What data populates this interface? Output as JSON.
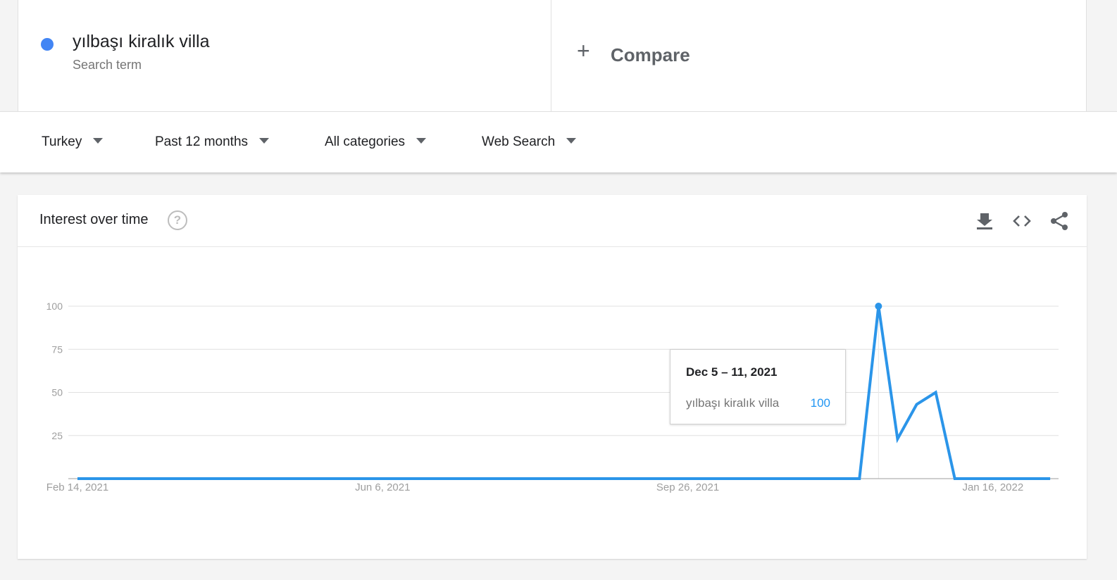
{
  "search_term": {
    "name": "yılbaşı kiralık villa",
    "subtitle": "Search term",
    "color": "#4285f4"
  },
  "compare": {
    "label": "Compare",
    "icon": "plus-icon"
  },
  "filters": [
    {
      "label": "Turkey"
    },
    {
      "label": "Past 12 months"
    },
    {
      "label": "All categories"
    },
    {
      "label": "Web Search"
    }
  ],
  "panel": {
    "title": "Interest over time",
    "icons": [
      "help-icon",
      "download-icon",
      "embed-code-icon",
      "share-icon"
    ]
  },
  "tooltip": {
    "date": "Dec 5 – 11, 2021",
    "term": "yılbaşı kiralık villa",
    "value": "100"
  },
  "chart_data": {
    "type": "line",
    "title": "",
    "xlabel": "",
    "ylabel": "",
    "ylim": [
      0,
      100
    ],
    "yticks": [
      25,
      50,
      75,
      100
    ],
    "x_tick_labels": [
      "Feb 14, 2021",
      "Jun 6, 2021",
      "Sep 26, 2021",
      "Jan 16, 2022"
    ],
    "x": [
      "2021-02-14",
      "2021-02-21",
      "2021-02-28",
      "2021-03-07",
      "2021-03-14",
      "2021-03-21",
      "2021-03-28",
      "2021-04-04",
      "2021-04-11",
      "2021-04-18",
      "2021-04-25",
      "2021-05-02",
      "2021-05-09",
      "2021-05-16",
      "2021-05-23",
      "2021-05-30",
      "2021-06-06",
      "2021-06-13",
      "2021-06-20",
      "2021-06-27",
      "2021-07-04",
      "2021-07-11",
      "2021-07-18",
      "2021-07-25",
      "2021-08-01",
      "2021-08-08",
      "2021-08-15",
      "2021-08-22",
      "2021-08-29",
      "2021-09-05",
      "2021-09-12",
      "2021-09-19",
      "2021-09-26",
      "2021-10-03",
      "2021-10-10",
      "2021-10-17",
      "2021-10-24",
      "2021-10-31",
      "2021-11-07",
      "2021-11-14",
      "2021-11-21",
      "2021-11-28",
      "2021-12-05",
      "2021-12-12",
      "2021-12-19",
      "2021-12-26",
      "2022-01-02",
      "2022-01-09",
      "2022-01-16",
      "2022-01-23",
      "2022-01-30",
      "2022-02-06"
    ],
    "series": [
      {
        "color": "#2b95e9",
        "values": [
          0,
          0,
          0,
          0,
          0,
          0,
          0,
          0,
          0,
          0,
          0,
          0,
          0,
          0,
          0,
          0,
          0,
          0,
          0,
          0,
          0,
          0,
          0,
          0,
          0,
          0,
          0,
          0,
          0,
          0,
          0,
          0,
          0,
          0,
          0,
          0,
          0,
          0,
          0,
          0,
          0,
          0,
          100,
          23,
          43,
          50,
          0,
          0,
          0,
          0,
          0,
          0
        ]
      }
    ],
    "highlight_index": 42,
    "grid": true,
    "legend": "none"
  }
}
